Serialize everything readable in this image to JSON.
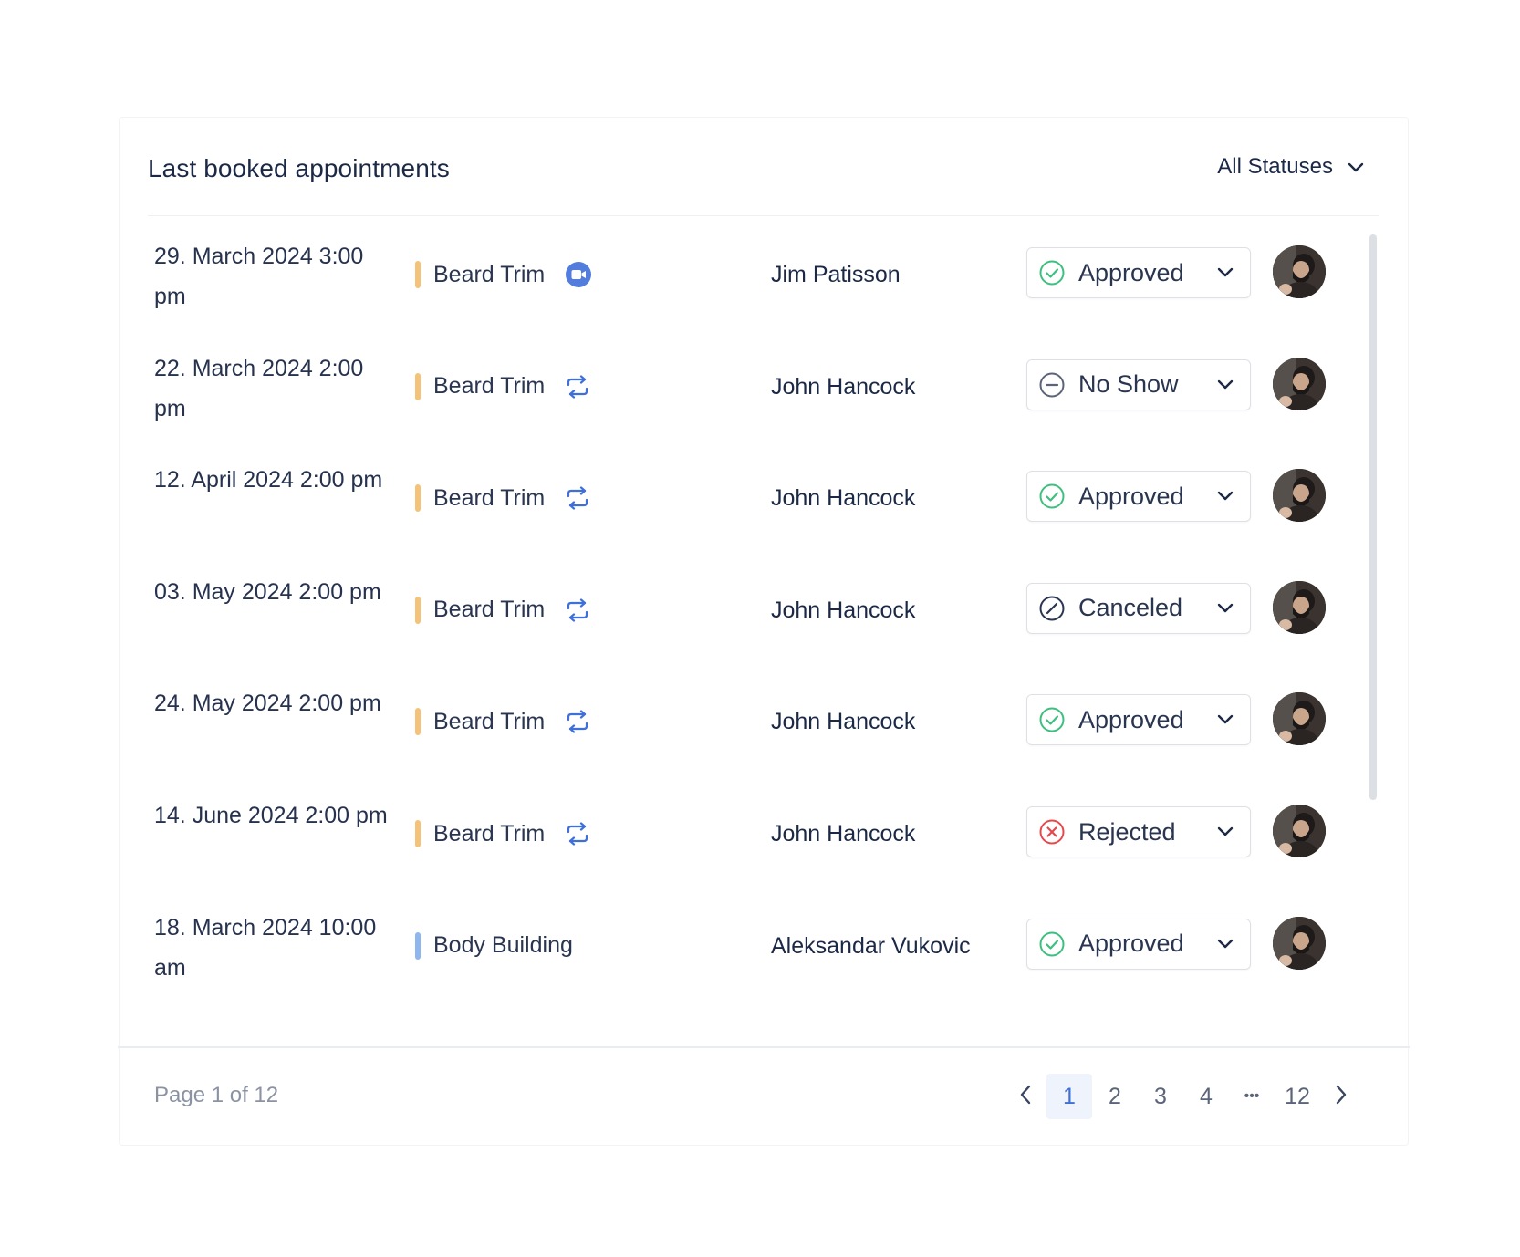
{
  "header": {
    "title": "Last booked appointments",
    "status_filter": "All Statuses"
  },
  "colors": {
    "beard_bar": "#f5c27a",
    "body_bar": "#8fb6ef",
    "approved": "#3fbf7f",
    "rejected": "#e5484d",
    "neutral_icon": "#5b6478",
    "accent": "#3f6fd8"
  },
  "appointments": [
    {
      "date": "29. March 2024 3:00 pm",
      "service": "Beard Trim",
      "service_icon": "video-camera-icon",
      "customer": "Jim Patisson",
      "status": "Approved",
      "status_icon": "check-circle-icon"
    },
    {
      "date": "22. March 2024 2:00 pm",
      "service": "Beard Trim",
      "service_icon": "recurring-icon",
      "customer": "John Hancock",
      "status": "No Show",
      "status_icon": "minus-circle-icon"
    },
    {
      "date": "12. April 2024 2:00 pm",
      "service": "Beard Trim",
      "service_icon": "recurring-icon",
      "customer": "John Hancock",
      "status": "Approved",
      "status_icon": "check-circle-icon"
    },
    {
      "date": "03. May 2024 2:00 pm",
      "service": "Beard Trim",
      "service_icon": "recurring-icon",
      "customer": "John Hancock",
      "status": "Canceled",
      "status_icon": "slash-circle-icon"
    },
    {
      "date": "24. May 2024 2:00 pm",
      "service": "Beard Trim",
      "service_icon": "recurring-icon",
      "customer": "John Hancock",
      "status": "Approved",
      "status_icon": "check-circle-icon"
    },
    {
      "date": "14. June 2024 2:00 pm",
      "service": "Beard Trim",
      "service_icon": "recurring-icon",
      "customer": "John Hancock",
      "status": "Rejected",
      "status_icon": "x-circle-icon"
    },
    {
      "date": "18. March 2024 10:00 am",
      "service": "Body Building",
      "service_icon": "",
      "customer": "Aleksandar Vukovic",
      "status": "Approved",
      "status_icon": "check-circle-icon"
    }
  ],
  "pagination": {
    "info": "Page 1 of 12",
    "pages": [
      "1",
      "2",
      "3",
      "4",
      "•••",
      "12"
    ],
    "current": "1"
  }
}
